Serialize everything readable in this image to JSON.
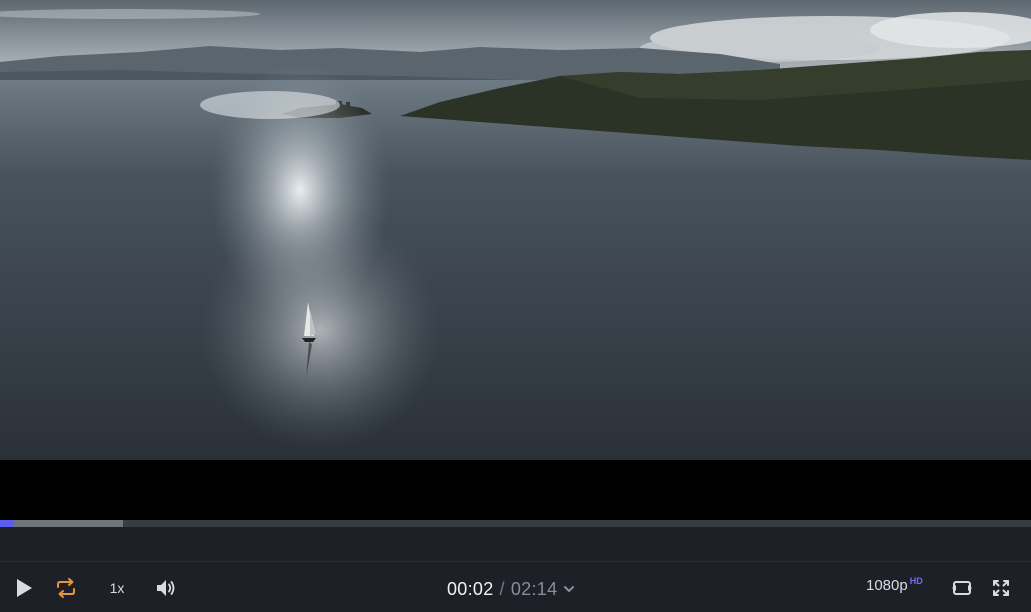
{
  "player": {
    "progress": {
      "played_fraction": 0.013,
      "buffered_fraction": 0.119
    },
    "controls": {
      "play_icon": "play-icon",
      "loop_icon": "loop-icon",
      "speed_label": "1x",
      "volume_icon": "volume-icon",
      "current_time": "00:02",
      "separator": "/",
      "duration": "02:14",
      "time_menu_icon": "chevron-down-icon",
      "quality_label": "1080p",
      "quality_badge": "HD",
      "theater_icon": "theater-mode-icon",
      "fullscreen_icon": "fullscreen-icon"
    },
    "colors": {
      "accent": "#5b5cf0",
      "loop_active": "#e8953a",
      "controls_bg": "#1e2028",
      "hd_badge": "#6b6cff"
    }
  }
}
